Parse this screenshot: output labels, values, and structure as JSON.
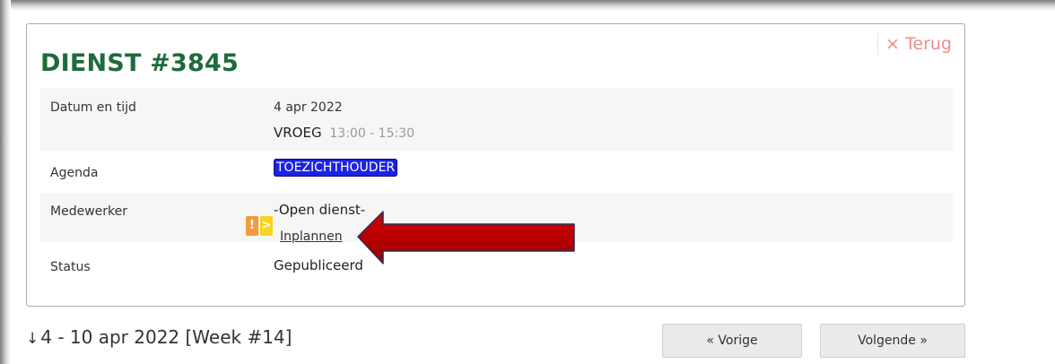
{
  "card": {
    "back_label": "× Terug",
    "title": "DIENST #3845",
    "rows": {
      "datetime": {
        "label": "Datum en tijd",
        "date": "4 apr 2022",
        "shift": "VROEG",
        "time": "13:00 - 15:30"
      },
      "agenda": {
        "label": "Agenda",
        "badge": "TOEZICHTHOUDER"
      },
      "employee": {
        "label": "Medewerker",
        "warn_icon": "!",
        "go_icon": ">",
        "value": "-Open dienst-",
        "link": "Inplannen"
      },
      "status": {
        "label": "Status",
        "value": "Gepubliceerd"
      }
    }
  },
  "week": {
    "arrow": "↓",
    "label": "4 - 10 apr 2022 [Week #14]"
  },
  "nav": {
    "prev": "« Vorige",
    "next": "Volgende »"
  },
  "colors": {
    "title": "#1e6b3c",
    "back": "#ec8b8b",
    "badge": "#1b23e6",
    "warn": "#f39c3c",
    "go": "#f7d31c",
    "arrow": "#c00000"
  }
}
